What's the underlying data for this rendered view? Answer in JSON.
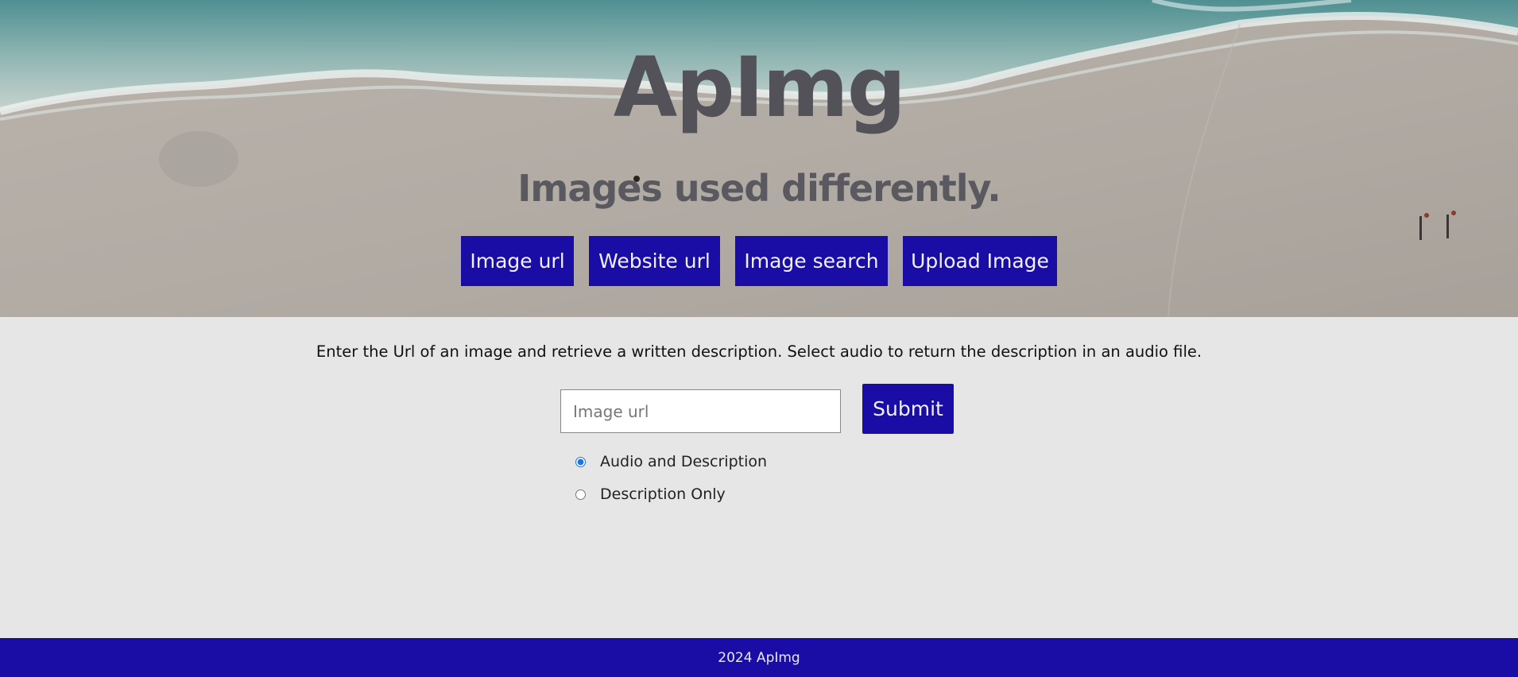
{
  "hero": {
    "title": "ApImg",
    "tagline": "Images used differently.",
    "buttons": [
      {
        "label": "Image url"
      },
      {
        "label": "Website url"
      },
      {
        "label": "Image search"
      },
      {
        "label": "Upload Image"
      }
    ]
  },
  "main": {
    "instructions": "Enter the Url of an image and retrieve a written description. Select audio to return the description in an audio file.",
    "url_input": {
      "placeholder": "Image url",
      "value": ""
    },
    "submit_label": "Submit",
    "options": [
      {
        "label": "Audio and Description",
        "checked": true
      },
      {
        "label": "Description Only",
        "checked": false
      }
    ]
  },
  "footer": {
    "text": "2024 ApImg"
  },
  "colors": {
    "accent": "#1a0da6",
    "page_background": "#e6e6e6",
    "title_text": "#545259"
  }
}
